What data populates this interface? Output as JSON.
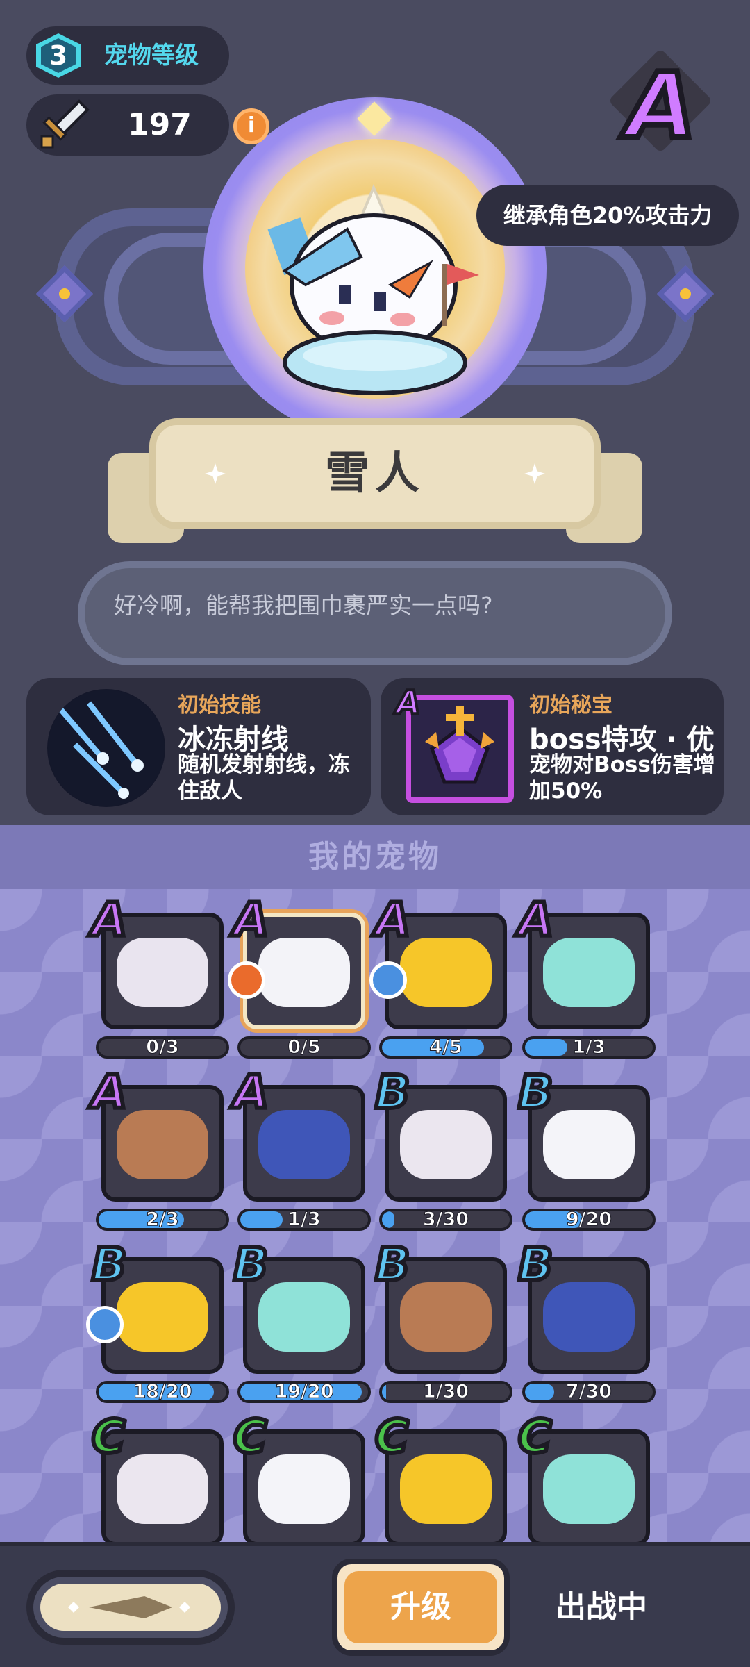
{
  "header": {
    "pet_level": "3",
    "pet_level_label": "宠物等级",
    "power": "197",
    "info_label": "i",
    "grade": "A",
    "inherit_text": "继承角色20%攻击力"
  },
  "pet": {
    "name": "雪人",
    "quote": "好冷啊，能帮我把围巾裹严实一点吗?"
  },
  "skill": {
    "title": "初始技能",
    "name": "冰冻射线",
    "desc": "随机发射射线，冻住敌人"
  },
  "treasure": {
    "grade": "A",
    "title": "初始秘宝",
    "name": "boss特攻 · 优",
    "desc": "宠物对Boss伤害增加50%"
  },
  "section_title": "我的宠物",
  "pets": [
    {
      "rank": "A",
      "progress": "0/3",
      "fraction": 0.0,
      "color": "#e9e4ef",
      "selected": false,
      "medal": ""
    },
    {
      "rank": "A",
      "progress": "0/5",
      "fraction": 0.0,
      "color": "#f3f3f8",
      "selected": true,
      "medal": "orange"
    },
    {
      "rank": "A",
      "progress": "4/5",
      "fraction": 0.8,
      "color": "#f6c629",
      "selected": false,
      "medal": "blue"
    },
    {
      "rank": "A",
      "progress": "1/3",
      "fraction": 0.33,
      "color": "#8fe2d8",
      "selected": false,
      "medal": ""
    },
    {
      "rank": "A",
      "progress": "2/3",
      "fraction": 0.67,
      "color": "#b97b54",
      "selected": false,
      "medal": ""
    },
    {
      "rank": "A",
      "progress": "1/3",
      "fraction": 0.33,
      "color": "#3f56b8",
      "selected": false,
      "medal": ""
    },
    {
      "rank": "B",
      "progress": "3/30",
      "fraction": 0.1,
      "color": "#ebe6ef",
      "selected": false,
      "medal": ""
    },
    {
      "rank": "B",
      "progress": "9/20",
      "fraction": 0.45,
      "color": "#f4f4f9",
      "selected": false,
      "medal": ""
    },
    {
      "rank": "B",
      "progress": "18/20",
      "fraction": 0.9,
      "color": "#f6c629",
      "selected": false,
      "medal": "blue"
    },
    {
      "rank": "B",
      "progress": "19/20",
      "fraction": 0.95,
      "color": "#8fe2d8",
      "selected": false,
      "medal": ""
    },
    {
      "rank": "B",
      "progress": "1/30",
      "fraction": 0.03,
      "color": "#b97b54",
      "selected": false,
      "medal": ""
    },
    {
      "rank": "B",
      "progress": "7/30",
      "fraction": 0.23,
      "color": "#3f56b8",
      "selected": false,
      "medal": ""
    },
    {
      "rank": "C",
      "progress": "",
      "fraction": 0.0,
      "color": "#ebe6ef",
      "selected": false,
      "medal": ""
    },
    {
      "rank": "C",
      "progress": "",
      "fraction": 0.0,
      "color": "#f4f4f9",
      "selected": false,
      "medal": ""
    },
    {
      "rank": "C",
      "progress": "",
      "fraction": 0.0,
      "color": "#f6c629",
      "selected": false,
      "medal": ""
    },
    {
      "rank": "C",
      "progress": "",
      "fraction": 0.0,
      "color": "#8fe2d8",
      "selected": false,
      "medal": ""
    }
  ],
  "bottom": {
    "upgrade_label": "升级",
    "battle_label": "出战中"
  }
}
